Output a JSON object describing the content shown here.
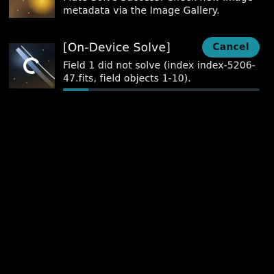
{
  "colors": {
    "background": "#000000",
    "accent": "#1a8fa0",
    "progress_track": "#243238",
    "progress_fill": "#1a7f8e",
    "text_primary": "#f2f2f2"
  },
  "previous_job": {
    "message": "Plate-Solve Success! Check new image metadata via the Image Gallery."
  },
  "solve_job": {
    "title": "[On-Device Solve]",
    "cancel_label": "Cancel",
    "status_message": "Field 1 did not solve (index index-5206-47.fits, field objects 1-10).",
    "progress_fraction": 0.13,
    "spinner_icon": "loading-spinner-icon"
  }
}
